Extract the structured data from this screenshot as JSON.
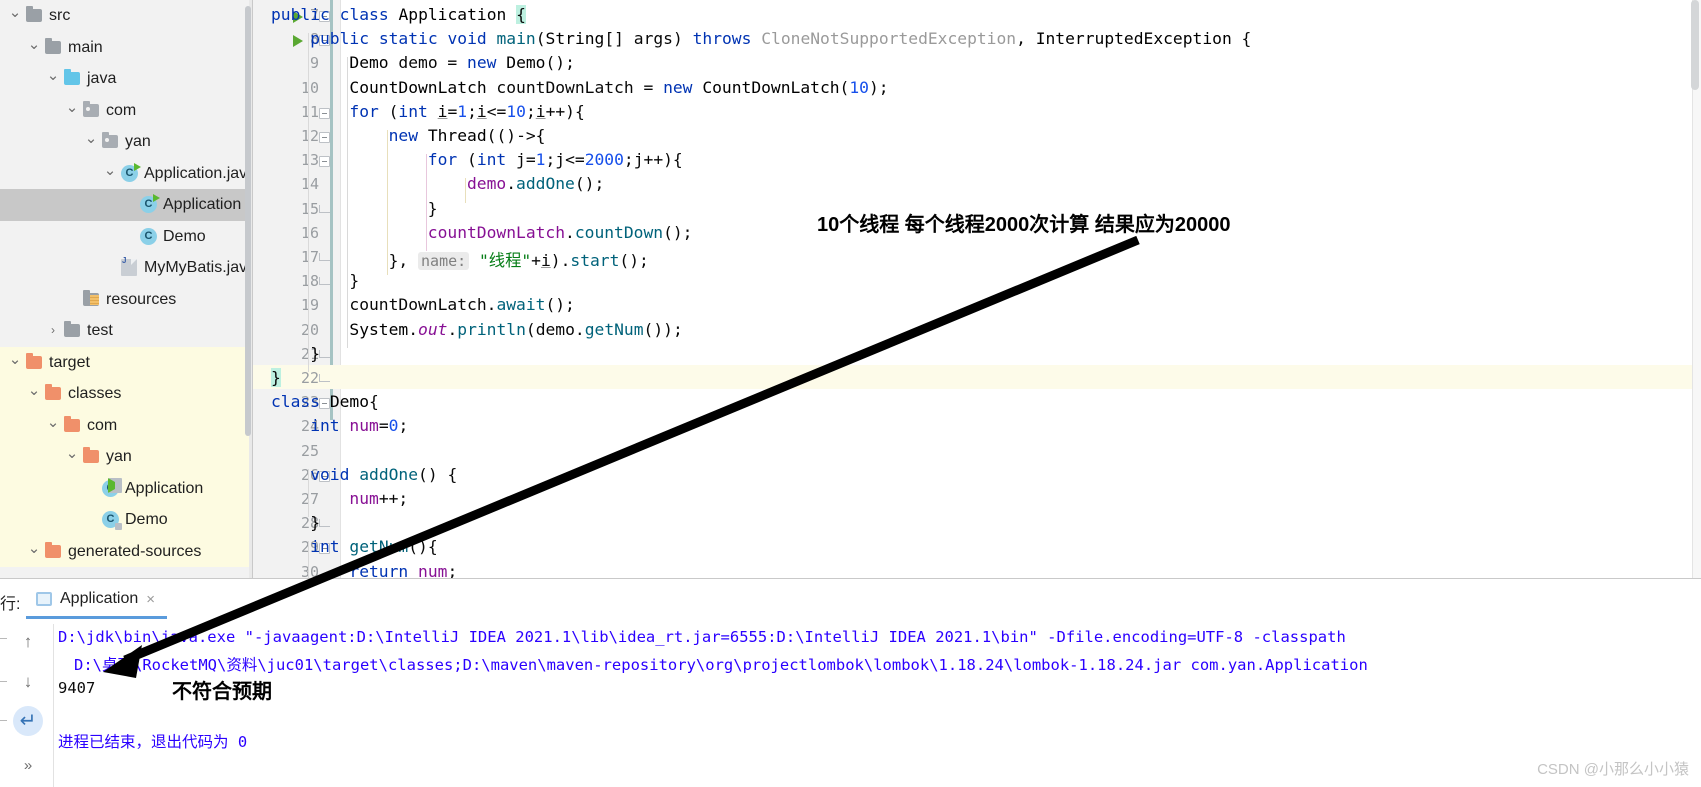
{
  "project_tree": {
    "rows": [
      {
        "label": "src",
        "indent": 0,
        "arrow": "chevron-down",
        "icon": "folder-gray",
        "selected": false,
        "target": false
      },
      {
        "label": "main",
        "indent": 1,
        "arrow": "chevron-down",
        "icon": "folder-gray",
        "selected": false,
        "target": false
      },
      {
        "label": "java",
        "indent": 2,
        "arrow": "chevron-down",
        "icon": "folder-blue",
        "selected": false,
        "target": false
      },
      {
        "label": "com",
        "indent": 3,
        "arrow": "chevron-down",
        "icon": "folder-package",
        "selected": false,
        "target": false
      },
      {
        "label": "yan",
        "indent": 4,
        "arrow": "chevron-down",
        "icon": "folder-package",
        "selected": false,
        "target": false
      },
      {
        "label": "Application.java",
        "indent": 5,
        "arrow": "chevron-down",
        "icon": "class-runnable",
        "selected": false,
        "target": false
      },
      {
        "label": "Application",
        "indent": 6,
        "arrow": "",
        "icon": "class-runnable",
        "selected": true,
        "target": false
      },
      {
        "label": "Demo",
        "indent": 6,
        "arrow": "",
        "icon": "class",
        "selected": false,
        "target": false
      },
      {
        "label": "MyMyBatis.java",
        "indent": 5,
        "arrow": "",
        "icon": "java-file",
        "selected": false,
        "target": false
      },
      {
        "label": "resources",
        "indent": 3,
        "arrow": "",
        "icon": "folder-resources",
        "selected": false,
        "target": false
      },
      {
        "label": "test",
        "indent": 2,
        "arrow": "chevron-right",
        "icon": "folder-gray",
        "selected": false,
        "target": false
      },
      {
        "label": "target",
        "indent": 0,
        "arrow": "chevron-down",
        "icon": "folder-orange",
        "selected": false,
        "target": true
      },
      {
        "label": "classes",
        "indent": 1,
        "arrow": "chevron-down",
        "icon": "folder-orange",
        "selected": false,
        "target": true
      },
      {
        "label": "com",
        "indent": 2,
        "arrow": "chevron-down",
        "icon": "folder-orange",
        "selected": false,
        "target": true
      },
      {
        "label": "yan",
        "indent": 3,
        "arrow": "chevron-down",
        "icon": "folder-orange",
        "selected": false,
        "target": true
      },
      {
        "label": "Application",
        "indent": 4,
        "arrow": "",
        "icon": "class-runnable-lock",
        "selected": false,
        "target": true
      },
      {
        "label": "Demo",
        "indent": 4,
        "arrow": "",
        "icon": "class-lock",
        "selected": false,
        "target": true
      },
      {
        "label": "generated-sources",
        "indent": 1,
        "arrow": "chevron-down",
        "icon": "folder-orange",
        "selected": false,
        "target": true
      }
    ]
  },
  "editor": {
    "lines": [
      {
        "n": 7,
        "run": true,
        "fold": "start"
      },
      {
        "n": 8,
        "run": true,
        "fold": "start"
      },
      {
        "n": 9,
        "run": false,
        "fold": ""
      },
      {
        "n": 10,
        "run": false,
        "fold": ""
      },
      {
        "n": 11,
        "run": false,
        "fold": "start"
      },
      {
        "n": 12,
        "run": false,
        "fold": "start"
      },
      {
        "n": 13,
        "run": false,
        "fold": "start"
      },
      {
        "n": 14,
        "run": false,
        "fold": ""
      },
      {
        "n": 15,
        "run": false,
        "fold": "end"
      },
      {
        "n": 16,
        "run": false,
        "fold": ""
      },
      {
        "n": 17,
        "run": false,
        "fold": "end"
      },
      {
        "n": 18,
        "run": false,
        "fold": "end"
      },
      {
        "n": 19,
        "run": false,
        "fold": ""
      },
      {
        "n": 20,
        "run": false,
        "fold": ""
      },
      {
        "n": 21,
        "run": false,
        "fold": "end"
      },
      {
        "n": 22,
        "run": false,
        "fold": "end"
      },
      {
        "n": 23,
        "run": false,
        "fold": "start"
      },
      {
        "n": 24,
        "run": false,
        "fold": ""
      },
      {
        "n": 25,
        "run": false,
        "fold": ""
      },
      {
        "n": 26,
        "run": false,
        "fold": "start"
      },
      {
        "n": 27,
        "run": false,
        "fold": ""
      },
      {
        "n": 28,
        "run": false,
        "fold": "end"
      },
      {
        "n": 29,
        "run": false,
        "fold": "start"
      },
      {
        "n": 30,
        "run": false,
        "fold": ""
      }
    ],
    "code": {
      "l7": "public class Application {",
      "l8": "public static void main(String[] args) throws CloneNotSupportedException, InterruptedException {",
      "l9": "Demo demo = new Demo();",
      "l10": "CountDownLatch countDownLatch = new CountDownLatch(10);",
      "l11": "for (int i=1;i<=10;i++){",
      "l12": "new Thread(()->{",
      "l13": "for (int j=1;j<=2000;j++){",
      "l14": "demo.addOne();",
      "l15": "}",
      "l16": "countDownLatch.countDown();",
      "l17": "}, name: \"线程\"+i).start();",
      "l18": "}",
      "l19": "countDownLatch.await();",
      "l20": "System.out.println(demo.getNum());",
      "l21": "}",
      "l22": "}",
      "l23": "class Demo{",
      "l24": "int num=0;",
      "l25": "",
      "l26": "void addOne() {",
      "l27": "num++;",
      "l28": "}",
      "l29": "int getNum(){",
      "l30": "return num;"
    },
    "hint_name": "name:"
  },
  "run_panel": {
    "run_label": "行:",
    "tab_label": "Application",
    "tab_close": "×",
    "toolbar": {
      "up_arrow": "↑",
      "down_arrow": "↓",
      "wrap_icon": "↵",
      "more": "»"
    },
    "console": {
      "line1": "D:\\jdk\\bin\\java.exe \"-javaagent:D:\\IntelliJ IDEA 2021.1\\lib\\idea_rt.jar=6555:D:\\IntelliJ IDEA 2021.1\\bin\" -Dfile.encoding=UTF-8 -classpath",
      "line2": "D:\\桌面\\RocketMQ\\资料\\juc01\\target\\classes;D:\\maven\\maven-repository\\org\\projectlombok\\lombok\\1.18.24\\lombok-1.18.24.jar com.yan.Application",
      "line3": "9407",
      "line4": "进程已结束，退出代码为 0"
    }
  },
  "annotations": {
    "top_note": "10个线程 每个线程2000次计算 结果应为20000",
    "bottom_note": "不符合预期"
  },
  "watermark": "CSDN @小那么小小猿",
  "colors": {
    "keyword": "#0033b3",
    "string": "#067d17",
    "number": "#1750eb",
    "field": "#871094",
    "method": "#00627a",
    "grayed": "#9a9a9a",
    "console_blue": "#2a00ff",
    "selection": "#c8c8c8",
    "target_bg": "#fdfbe1",
    "tab_accent": "#5a9bdc"
  }
}
